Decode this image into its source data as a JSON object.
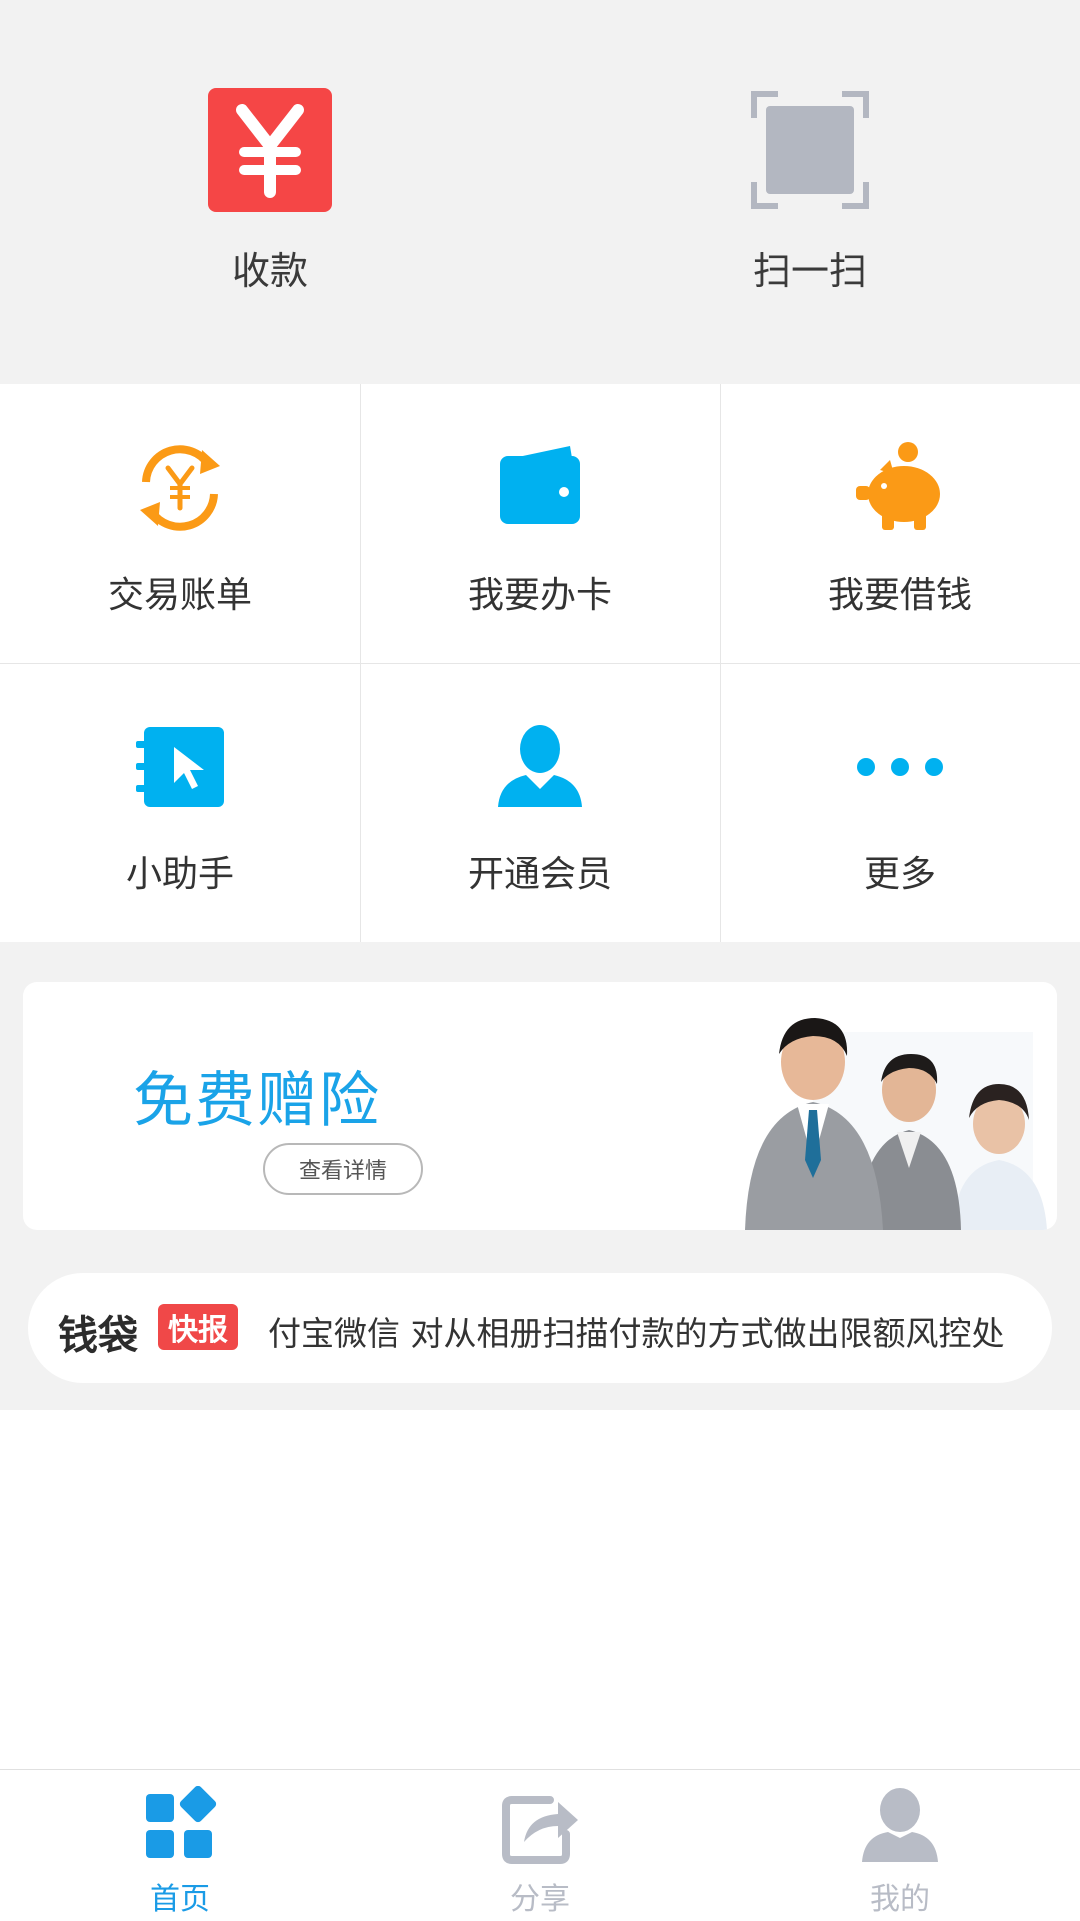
{
  "quick_actions": [
    {
      "label": "收款",
      "icon": "yen-icon"
    },
    {
      "label": "扫一扫",
      "icon": "scan-icon"
    }
  ],
  "grid": [
    {
      "label": "交易账单",
      "icon": "bill-refresh-icon"
    },
    {
      "label": "我要办卡",
      "icon": "wallet-icon"
    },
    {
      "label": "我要借钱",
      "icon": "piggy-bank-icon"
    },
    {
      "label": "小助手",
      "icon": "assistant-cursor-icon"
    },
    {
      "label": "开通会员",
      "icon": "member-user-icon"
    },
    {
      "label": "更多",
      "icon": "more-dots-icon"
    }
  ],
  "banner": {
    "title": "免费赠险",
    "button_label": "查看详情"
  },
  "news": {
    "brand": "钱袋",
    "tag": "快报",
    "text": "付宝微信 对从相册扫描付款的方式做出限额风控处"
  },
  "tabs": [
    {
      "label": "首页",
      "icon": "home-grid-icon",
      "active": true
    },
    {
      "label": "分享",
      "icon": "share-icon",
      "active": false
    },
    {
      "label": "我的",
      "icon": "profile-icon",
      "active": false
    }
  ],
  "colors": {
    "accent": "#1aa3e8",
    "yen_red": "#f54646",
    "orange": "#fb9a16",
    "scan_grey": "#b3b7c1",
    "tab_inactive": "#b8bcc6",
    "tag_red": "#f04848"
  }
}
